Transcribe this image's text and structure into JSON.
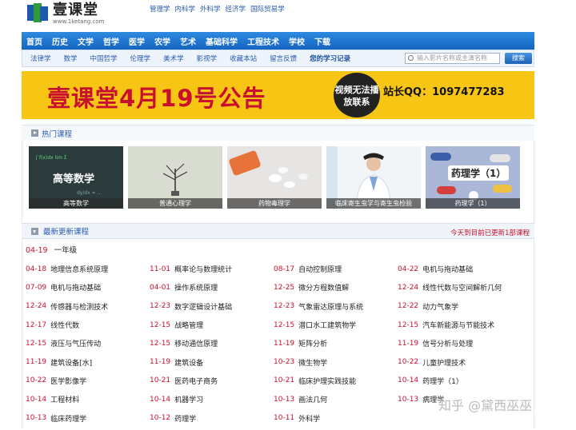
{
  "logo": {
    "name": "壹课堂",
    "url": "www.1ketang.com"
  },
  "top_links": [
    "管理学",
    "内科学",
    "外科学",
    "经济学",
    "国际贸易学"
  ],
  "nav": [
    "首页",
    "历史",
    "文学",
    "哲学",
    "医学",
    "农学",
    "艺术",
    "基础科学",
    "工程技术",
    "学校",
    "下载"
  ],
  "subnav": [
    "法律学",
    "数学",
    "中国哲学",
    "伦理学",
    "美术学",
    "影视学",
    "收藏本站",
    "留言反馈",
    "您的学习记录"
  ],
  "search": {
    "placeholder": "输入影片名称或主演名称",
    "button": "搜索"
  },
  "banner": {
    "title": "壹课堂4月19号公告",
    "circle_text": "视频无法播放联系",
    "qq": "站长QQ：1097477283"
  },
  "hot": {
    "title": "热门课程",
    "items": [
      "高等数学",
      "普通心理学",
      "药物毒理学",
      "临床寄生虫学与寄生虫检验",
      "药理学（1）"
    ],
    "thumb1_text": "高等数学",
    "thumb5_text": "药理学（1）"
  },
  "latest": {
    "title": "最新更新课程",
    "notice": "今天到目前已更新1部课程",
    "first_date": "04-19",
    "first_title": "一年级"
  },
  "courses": [
    [
      [
        "04-18",
        "地理信息系统原理"
      ],
      [
        "11-01",
        "概率论与数理统计"
      ],
      [
        "08-17",
        "自动控制原理"
      ],
      [
        "04-22",
        "电机与拖动基础"
      ]
    ],
    [
      [
        "07-09",
        "电机与拖动基础"
      ],
      [
        "04-01",
        "操作系统原理"
      ],
      [
        "12-25",
        "微分方程数值解"
      ],
      [
        "12-24",
        "线性代数与空间解析几何"
      ]
    ],
    [
      [
        "12-24",
        "传感器与检测技术"
      ],
      [
        "12-23",
        "数字逻辑设计基础"
      ],
      [
        "12-23",
        "气象雷达原理与系统"
      ],
      [
        "12-22",
        "动力气象学"
      ]
    ],
    [
      [
        "12-17",
        "线性代数"
      ],
      [
        "12-15",
        "战略管理"
      ],
      [
        "12-15",
        "潜口水工建筑物学"
      ],
      [
        "12-15",
        "汽车新能源与节能技术"
      ]
    ],
    [
      [
        "12-15",
        "液压与气压传动"
      ],
      [
        "12-15",
        "移动通信原理"
      ],
      [
        "11-19",
        "矩阵分析"
      ],
      [
        "11-19",
        "信号分析与处理"
      ]
    ],
    [
      [
        "11-19",
        "建筑设备[水]"
      ],
      [
        "11-19",
        "建筑设备"
      ],
      [
        "10-23",
        "微生物学"
      ],
      [
        "10-22",
        "儿童护理技术"
      ]
    ],
    [
      [
        "10-22",
        "医学影像学"
      ],
      [
        "10-21",
        "医药电子商务"
      ],
      [
        "10-21",
        "临床护理实践技能"
      ],
      [
        "10-14",
        "药理学（1）"
      ]
    ],
    [
      [
        "10-14",
        "工程材料"
      ],
      [
        "10-14",
        "机器学习"
      ],
      [
        "10-13",
        "画法几何"
      ],
      [
        "10-13",
        "病理学"
      ]
    ],
    [
      [
        "10-13",
        "临床药理学"
      ],
      [
        "10-12",
        "药理学"
      ],
      [
        "10-11",
        "外科学"
      ],
      [
        "",
        ""
      ]
    ]
  ],
  "watermark": "知乎 @黛西巫巫",
  "colors": {
    "nav_blue": "#1565c0",
    "date_red": "#c8102e",
    "banner_yellow": "#f7c514"
  }
}
